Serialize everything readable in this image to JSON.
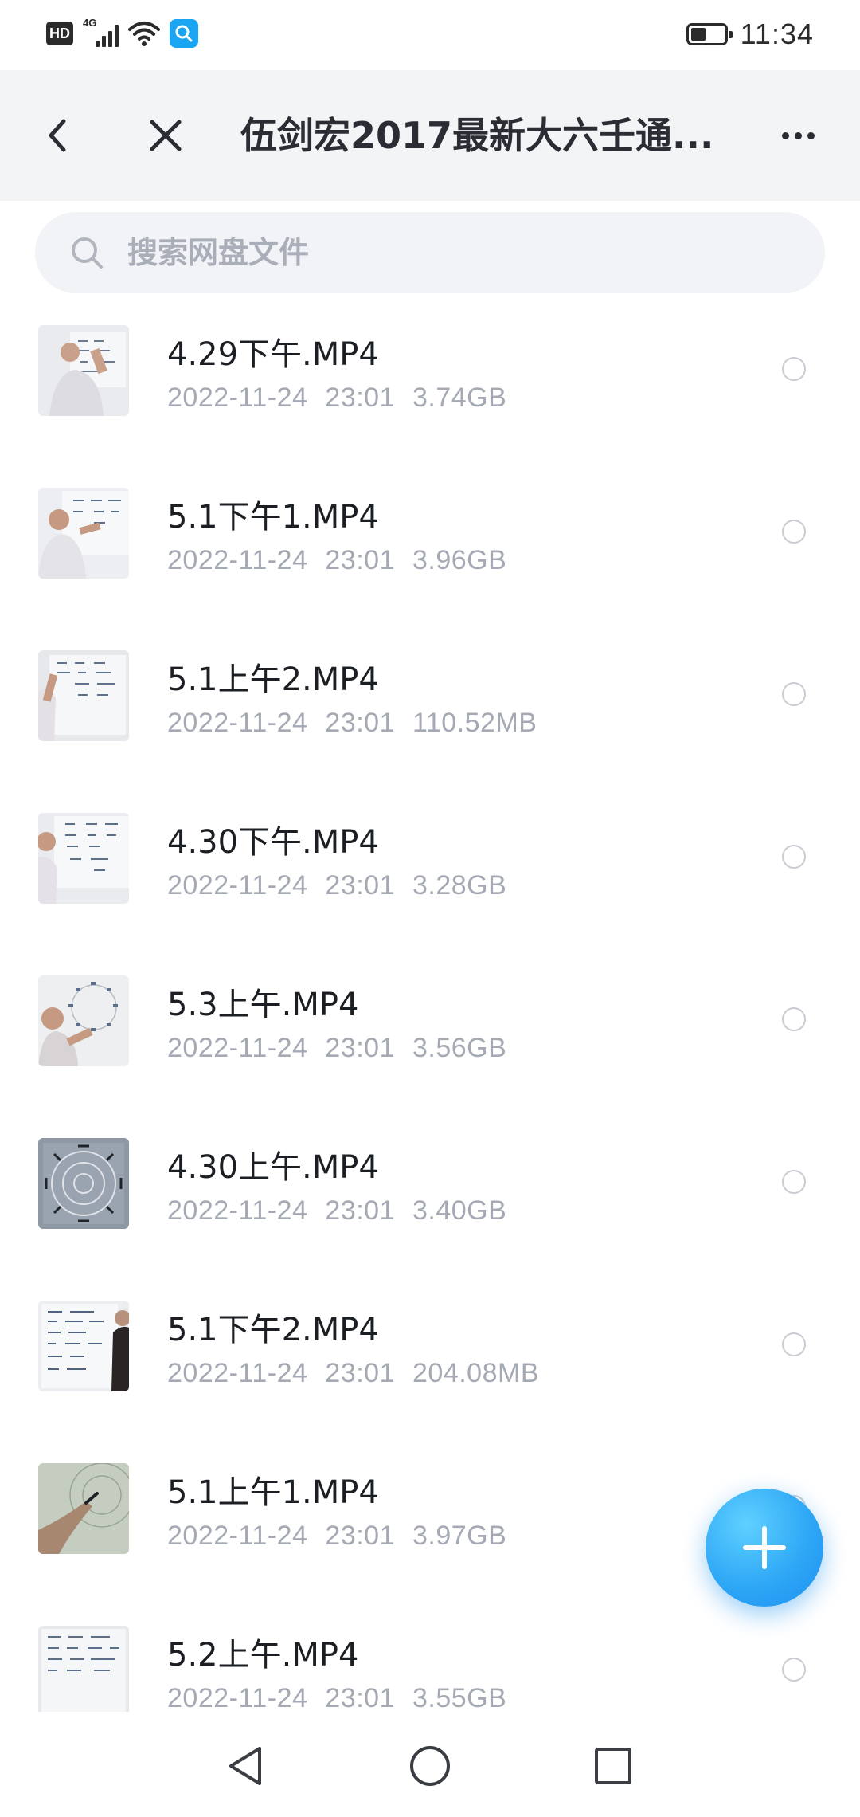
{
  "status_bar": {
    "hd_label": "HD",
    "network_label": "4G",
    "time": "11:34",
    "battery_level": 0.45
  },
  "header": {
    "title": "伍剑宏2017最新大六壬通...",
    "back_icon": "chevron-left-icon",
    "close_icon": "close-icon",
    "more_icon": "more-horizontal-icon"
  },
  "search": {
    "placeholder": "搜索网盘文件"
  },
  "files": [
    {
      "name": "4.29下午.MP4",
      "date": "2022-11-24",
      "time": "23:01",
      "size": "3.74GB"
    },
    {
      "name": "5.1下午1.MP4",
      "date": "2022-11-24",
      "time": "23:01",
      "size": "3.96GB"
    },
    {
      "name": "5.1上午2.MP4",
      "date": "2022-11-24",
      "time": "23:01",
      "size": "110.52MB"
    },
    {
      "name": "4.30下午.MP4",
      "date": "2022-11-24",
      "time": "23:01",
      "size": "3.28GB"
    },
    {
      "name": "5.3上午.MP4",
      "date": "2022-11-24",
      "time": "23:01",
      "size": "3.56GB"
    },
    {
      "name": "4.30上午.MP4",
      "date": "2022-11-24",
      "time": "23:01",
      "size": "3.40GB"
    },
    {
      "name": "5.1下午2.MP4",
      "date": "2022-11-24",
      "time": "23:01",
      "size": "204.08MB"
    },
    {
      "name": "5.1上午1.MP4",
      "date": "2022-11-24",
      "time": "23:01",
      "size": "3.97GB"
    },
    {
      "name": "5.2上午.MP4",
      "date": "2022-11-24",
      "time": "23:01",
      "size": "3.55GB"
    }
  ],
  "fab": {
    "icon": "plus-icon",
    "color": "#2fa8f6"
  },
  "system_nav": {
    "back_icon": "triangle-back-icon",
    "home_icon": "circle-home-icon",
    "recents_icon": "square-recents-icon"
  },
  "colors": {
    "accent": "#2fa8f6",
    "header_bg": "#f3f4f6",
    "meta_text": "#a4a9b3"
  }
}
